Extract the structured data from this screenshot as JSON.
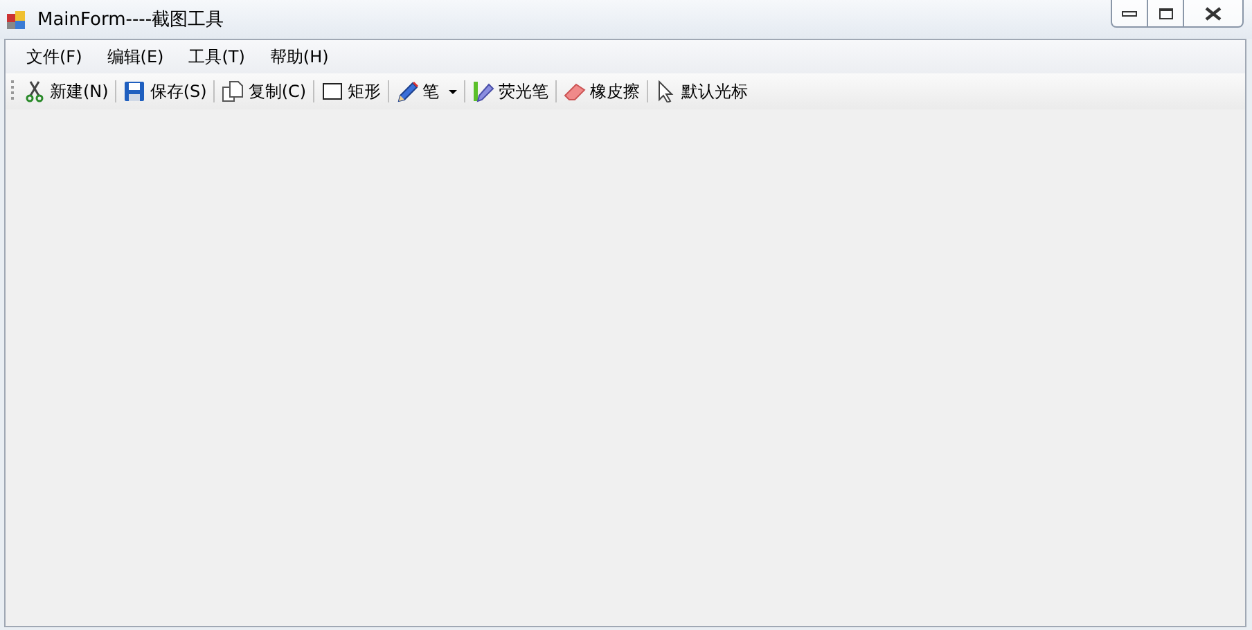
{
  "window": {
    "title": "MainForm----截图工具"
  },
  "menu": [
    {
      "label": "文件(F)"
    },
    {
      "label": "编辑(E)"
    },
    {
      "label": "工具(T)"
    },
    {
      "label": "帮助(H)"
    }
  ],
  "toolbar": [
    {
      "kind": "scissors",
      "label": "新建(N)",
      "dropdown": false
    },
    {
      "kind": "disk",
      "label": "保存(S)",
      "dropdown": false
    },
    {
      "kind": "copy",
      "label": "复制(C)",
      "dropdown": false
    },
    {
      "kind": "rect",
      "label": "矩形",
      "dropdown": false
    },
    {
      "kind": "pencil",
      "label": "笔",
      "dropdown": true
    },
    {
      "kind": "marker",
      "label": "荧光笔",
      "dropdown": false
    },
    {
      "kind": "eraser",
      "label": "橡皮擦",
      "dropdown": false
    },
    {
      "kind": "cursor",
      "label": "默认光标",
      "dropdown": false
    }
  ]
}
